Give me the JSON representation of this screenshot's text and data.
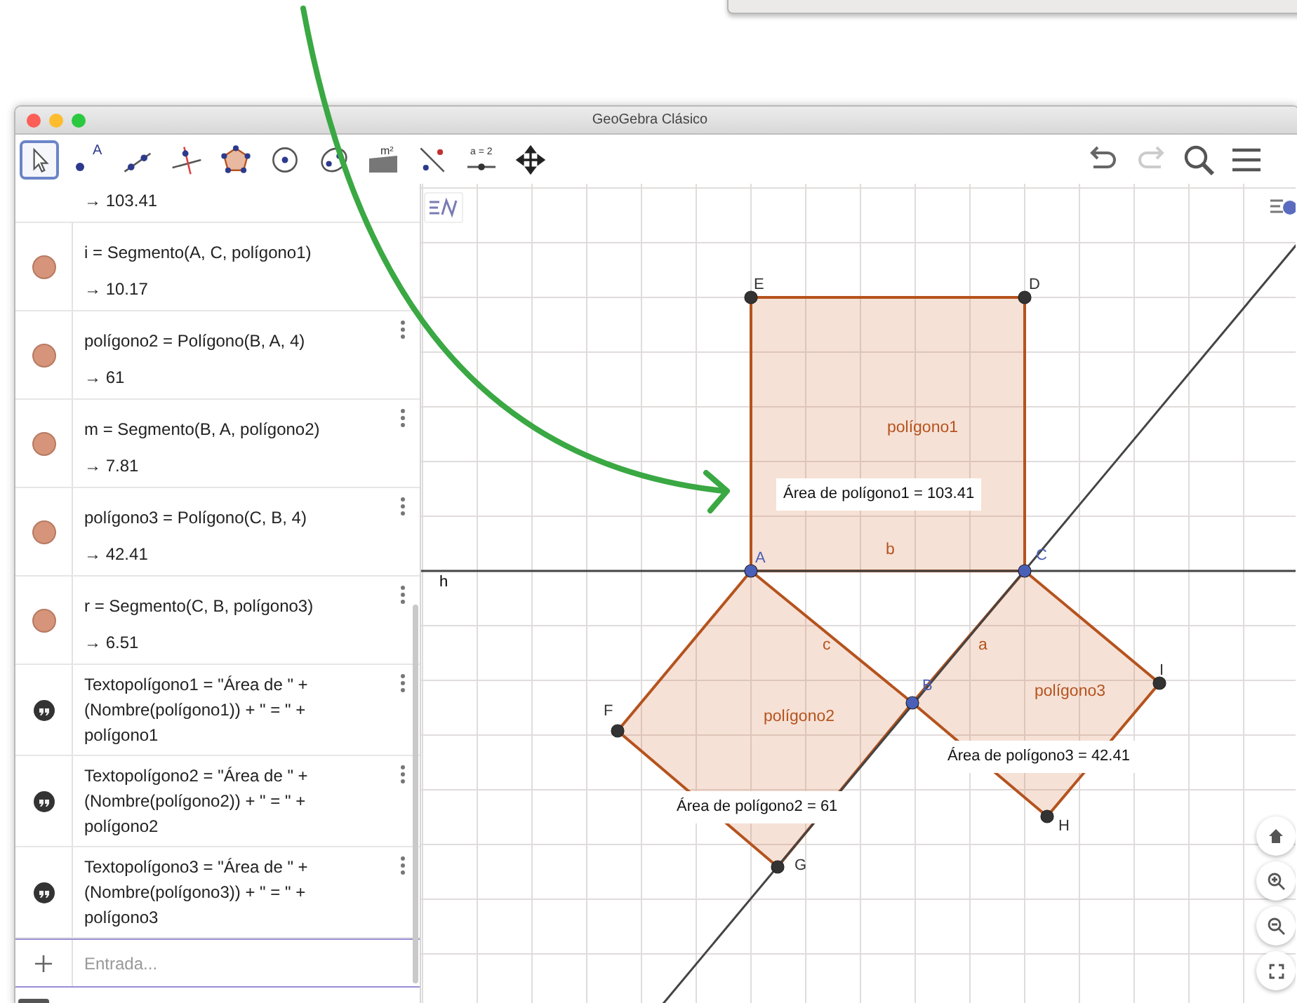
{
  "window": {
    "title": "GeoGebra Clásico"
  },
  "toolbar": {
    "tools": [
      {
        "kind": "move",
        "selected": true
      },
      {
        "kind": "point",
        "selected": false,
        "label": "A"
      },
      {
        "kind": "line",
        "selected": false
      },
      {
        "kind": "perpendicular",
        "selected": false
      },
      {
        "kind": "polygon",
        "selected": false
      },
      {
        "kind": "circle",
        "selected": false
      },
      {
        "kind": "conic",
        "selected": false
      },
      {
        "kind": "measure",
        "selected": false,
        "label": "m²"
      },
      {
        "kind": "reflect",
        "selected": false
      },
      {
        "kind": "slider",
        "selected": false,
        "label": "a = 2"
      },
      {
        "kind": "move_view",
        "selected": false
      }
    ]
  },
  "algebra": {
    "items": [
      {
        "kind": "value_only",
        "value": "→  103.41",
        "menu": false
      },
      {
        "kind": "object",
        "definition": "i = Segmento(A, C, polígono1)",
        "value": "→  10.17",
        "menu": false
      },
      {
        "kind": "object",
        "definition": "polígono2 = Polígono(B, A, 4)",
        "value": "→  61",
        "menu": true
      },
      {
        "kind": "object",
        "definition": "m = Segmento(B, A, polígono2)",
        "value": "→  7.81",
        "menu": true
      },
      {
        "kind": "object",
        "definition": "polígono3 = Polígono(C, B, 4)",
        "value": "→  42.41",
        "menu": true
      },
      {
        "kind": "object",
        "definition": "r = Segmento(C, B, polígono3)",
        "value": "→  6.51",
        "menu": true
      },
      {
        "kind": "text",
        "definition": "Textopolígono1 = \"Área de \" + (Nombre(polígono1)) + \" = \" + polígono1",
        "menu": true
      },
      {
        "kind": "text",
        "definition": "Textopolígono2 = \"Área de \" + (Nombre(polígono2)) + \" = \" + polígono2",
        "menu": true
      },
      {
        "kind": "text",
        "definition": "Textopolígono3 = \"Área de \" + (Nombre(polígono3)) + \" = \" + polígono3",
        "menu": true
      }
    ],
    "input": {
      "placeholder": "Entrada..."
    }
  },
  "graphics": {
    "line_label": "h",
    "points": [
      {
        "label": "E",
        "kind": "dependent"
      },
      {
        "label": "D",
        "kind": "dependent"
      },
      {
        "label": "A",
        "kind": "free"
      },
      {
        "label": "C",
        "kind": "free"
      },
      {
        "label": "B",
        "kind": "free"
      },
      {
        "label": "F",
        "kind": "dependent"
      },
      {
        "label": "G",
        "kind": "dependent"
      },
      {
        "label": "H",
        "kind": "dependent"
      },
      {
        "label": "I",
        "kind": "dependent"
      }
    ],
    "polygons": [
      {
        "label": "polígono1"
      },
      {
        "label": "polígono2"
      },
      {
        "label": "polígono3"
      }
    ],
    "segments": [
      {
        "label": "b"
      },
      {
        "label": "c"
      },
      {
        "label": "a"
      }
    ],
    "texts": [
      "Área de polígono1 = 103.41",
      "Área de polígono2 = 61",
      "Área de polígono3 = 42.41"
    ]
  }
}
